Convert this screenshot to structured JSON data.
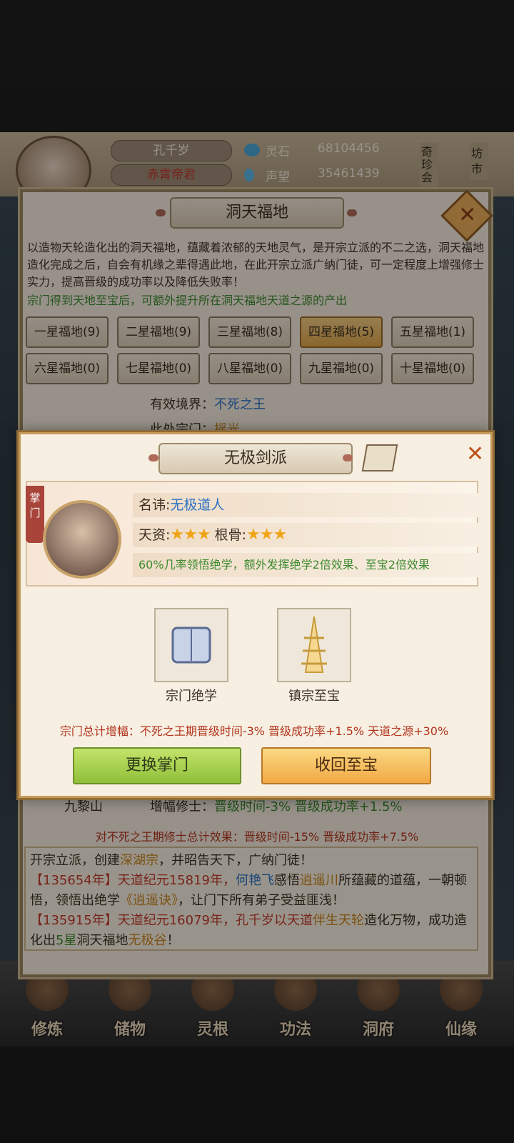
{
  "player": {
    "name": "孔千岁",
    "title": "赤霄帝君",
    "currency1_label": "灵石",
    "currency1_value": "68104456",
    "currency2_label": "声望",
    "currency2_value": "35461439",
    "side_tab1": "奇珍会",
    "side_tab2": "坊市"
  },
  "main_panel": {
    "title": "洞天福地",
    "description": "以造物天轮造化出的洞天福地，蕴藏着浓郁的天地灵气，是开宗立派的不二之选，洞天福地造化完成之后，自会有机缘之辈得遇此地，在此开宗立派广纳门徒，可一定程度上增强修士实力，提高晋级的成功率以及降低失败率！",
    "note": "宗门得到天地至宝后，可额外提升所在洞天福地天道之源的产出",
    "tiers": [
      "一星福地(9)",
      "二星福地(9)",
      "三星福地(8)",
      "四星福地(5)",
      "五星福地(1)",
      "六星福地(0)",
      "七星福地(0)",
      "八星福地(0)",
      "九星福地(0)",
      "十星福地(0)"
    ],
    "realm_label": "有效境界：",
    "realm_value": "不死之王",
    "sect_label": "此处宗门：",
    "sect_value": "摇光",
    "mountain_name": "九黎山",
    "boost_label": "增幅修士：",
    "boost_value": "晋级时间-3% 晋级成功率+1.5%",
    "total_effect": "对不死之王期修士总计效果：晋级时间-15% 晋级成功率+7.5%",
    "log_1a": "开宗立派，创建",
    "log_1b": "深湖宗",
    "log_1c": "，并昭告天下，广纳门徒！",
    "log_2a": "【135654年】天道纪元15819年，",
    "log_2b": "何艳飞",
    "log_2c": "感悟",
    "log_2d": "逍遥川",
    "log_2e": "所蕴藏的道蕴，一朝顿悟，领悟出绝学",
    "log_2f": "《逍遥诀》",
    "log_2g": "，让门下所有弟子受益匪浅！",
    "log_3a": "【135915年】天道纪元16079年，孔千岁以天道",
    "log_3b": "伴生天轮",
    "log_3c": "造化万物，成功造化出",
    "log_3d": "5星",
    "log_3e": "洞天福地",
    "log_3f": "无极谷",
    "log_3g": "！"
  },
  "popup": {
    "title": "无极剑派",
    "leader_tag": "掌门",
    "name_label": "名讳:",
    "name_value": "无极道人",
    "talent_label": "天资:",
    "talent_stars": 3,
    "root_label": "根骨:",
    "root_stars": 3,
    "skill_text": "60%几率领悟绝学，额外发挥绝学2倍效果、至宝2倍效果",
    "item1_label": "宗门绝学",
    "item2_label": "镇宗至宝",
    "effect_text": "宗门总计增幅：不死之王期晋级时间-3% 晋级成功率+1.5% 天道之源+30%",
    "btn_change": "更换掌门",
    "btn_recall": "收回至宝"
  },
  "nav": [
    "修炼",
    "储物",
    "灵根",
    "功法",
    "洞府",
    "仙缘"
  ],
  "colors": {
    "accent_green": "#3d8a2e",
    "accent_red": "#b3341d",
    "accent_blue": "#2b72c4",
    "gold": "#f0a414"
  }
}
